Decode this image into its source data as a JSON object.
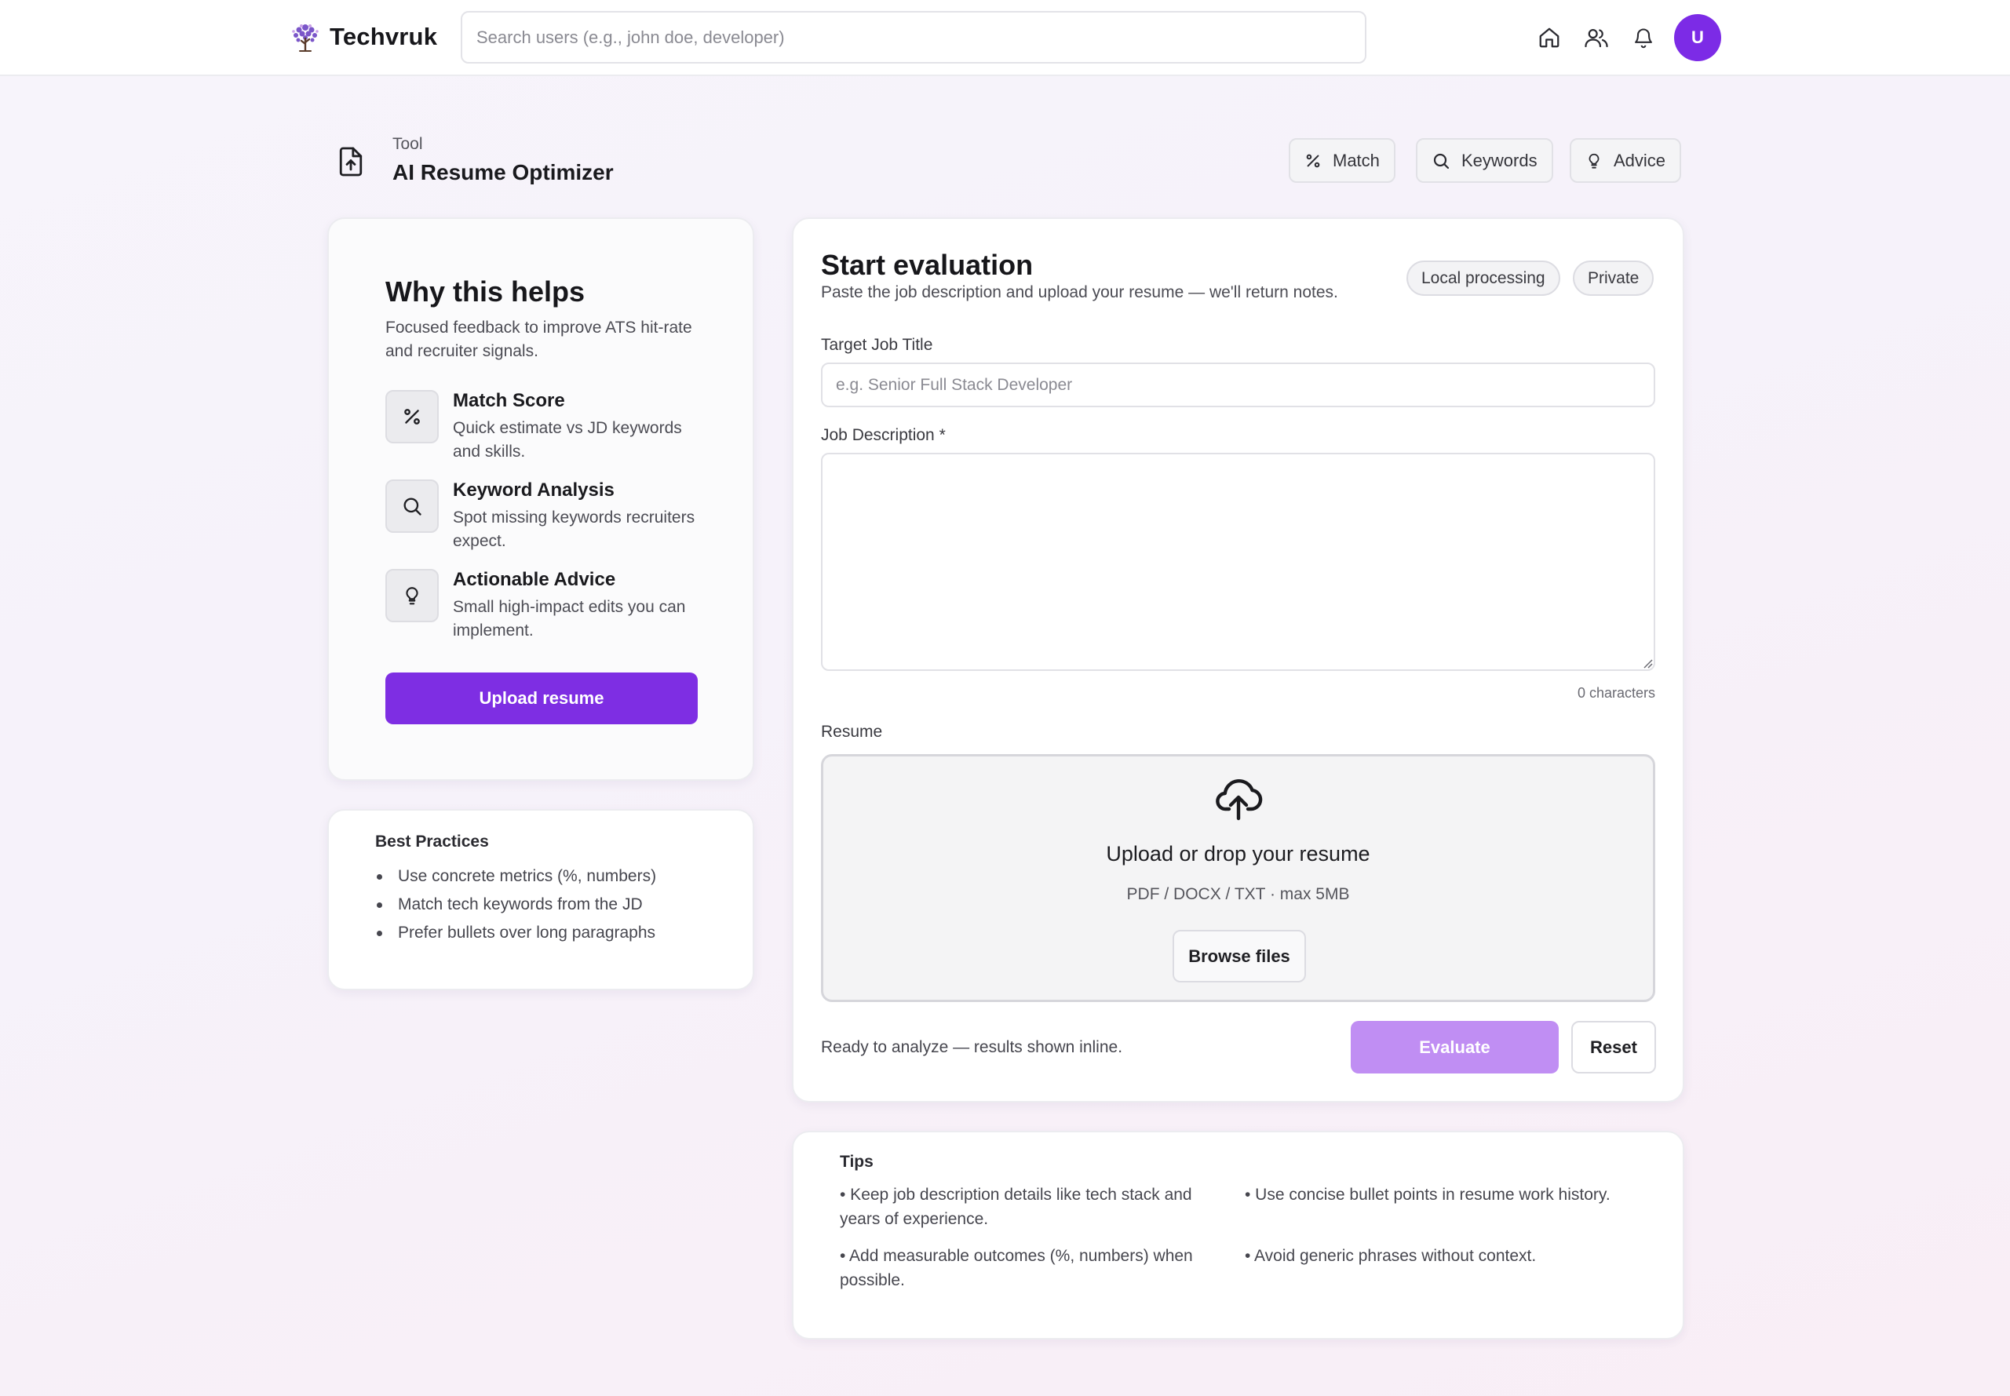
{
  "header": {
    "brand": "Techvruk",
    "search_placeholder": "Search users (e.g., john doe, developer)",
    "avatar_initial": "U",
    "icons": [
      "home-icon",
      "users-icon",
      "bell-icon"
    ]
  },
  "tool": {
    "kicker": "Tool",
    "title": "AI Resume Optimizer",
    "actions": [
      {
        "label": "Match",
        "icon": "percent-icon"
      },
      {
        "label": "Keywords",
        "icon": "search-icon"
      },
      {
        "label": "Advice",
        "icon": "lightbulb-icon"
      }
    ]
  },
  "why": {
    "title": "Why this helps",
    "subtitle": "Focused feedback to improve ATS hit-rate and recruiter signals.",
    "features": [
      {
        "title": "Match Score",
        "desc": "Quick estimate vs JD keywords and skills.",
        "icon": "percent-icon"
      },
      {
        "title": "Keyword Analysis",
        "desc": "Spot missing keywords recruiters expect.",
        "icon": "search-icon"
      },
      {
        "title": "Actionable Advice",
        "desc": "Small high-impact edits you can implement.",
        "icon": "lightbulb-icon"
      }
    ],
    "upload_button": "Upload resume"
  },
  "best_practices": {
    "title": "Best Practices",
    "items": [
      "Use concrete metrics (%, numbers)",
      "Match tech keywords from the JD",
      "Prefer bullets over long paragraphs"
    ]
  },
  "evaluation": {
    "title": "Start evaluation",
    "subtitle": "Paste the job description and upload your resume — we'll return notes.",
    "badges": [
      "Local processing",
      "Private"
    ],
    "job_title_label": "Target Job Title",
    "job_title_placeholder": "e.g. Senior Full Stack Developer",
    "job_title_value": "",
    "jd_label": "Job Description *",
    "jd_value": "",
    "char_count": "0 characters",
    "resume_label": "Resume",
    "dropzone_title": "Upload or drop your resume",
    "dropzone_sub": "PDF / DOCX / TXT · max 5MB",
    "browse_button": "Browse files",
    "status": "Ready to analyze — results shown inline.",
    "evaluate_button": "Evaluate",
    "reset_button": "Reset"
  },
  "tips": {
    "title": "Tips",
    "items": [
      "• Keep job description details like tech stack and years of experience.",
      "• Use concise bullet points in resume work history.",
      "• Add measurable outcomes (%, numbers) when possible.",
      "• Avoid generic phrases without context."
    ]
  },
  "colors": {
    "accent": "#7e2ee3",
    "accent_disabled": "#c08ef3",
    "avatar": "#7c2be6"
  }
}
